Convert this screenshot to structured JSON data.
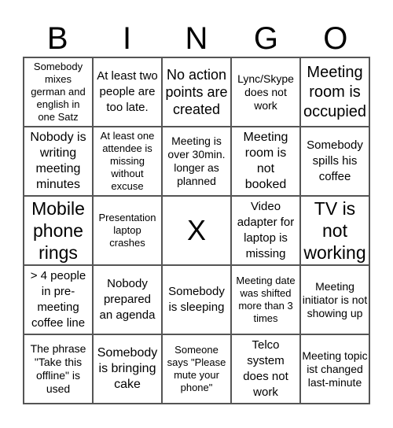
{
  "title_letters": [
    "B",
    "I",
    "N",
    "G",
    "O"
  ],
  "cells": [
    "Somebody mixes german and english in one Satz",
    "At least two people are too late.",
    "No action points are created",
    "Lync/Skype does not work",
    "Meeting room is occupied",
    "Nobody is writing meeting minutes",
    "At least one attendee is missing without excuse",
    "Meeting is over 30min. longer as planned",
    "Meeting room is not booked",
    "Somebody spills his coffee",
    "Mobile phone rings",
    "Presentation laptop crashes",
    "X",
    "Video adapter for laptop is missing",
    "TV is not working",
    "> 4 people in pre-meeting coffee line",
    "Nobody prepared an agenda",
    "Somebody is sleeping",
    "Meeting date was shifted more than 3 times",
    "Meeting initiator is not showing up",
    "The phrase \"Take this offline\" is used",
    "Somebody is bringing cake",
    "Someone says \"Please mute your phone\"",
    "Telco system does not work",
    "Meeting topic ist changed last-minute"
  ]
}
